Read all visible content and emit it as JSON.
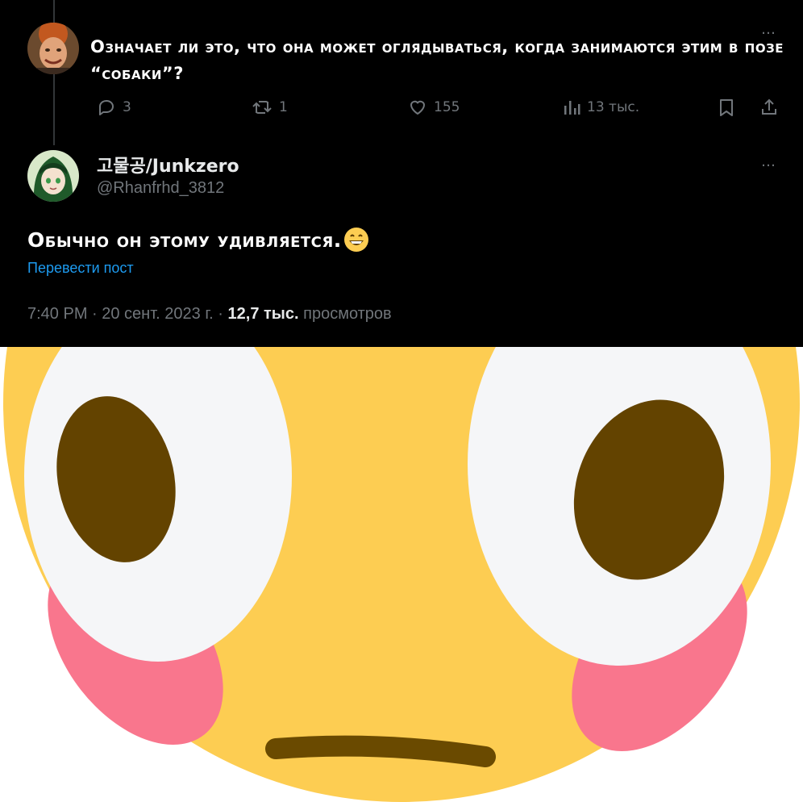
{
  "parent_tweet": {
    "text": "Означает ли это, что она может оглядываться, когда занимаются этим в позе “собаки”?",
    "more_icon": "…",
    "actions": {
      "reply_count": "3",
      "retweet_count": "1",
      "like_count": "155",
      "views": "13 тыс."
    }
  },
  "reply_tweet": {
    "name": "고물공/Junkzero",
    "handle": "@Rhanfrhd_3812",
    "more_icon": "…",
    "text": "Обычно он этому удивляется.",
    "emoji": "grinning-face-emoji",
    "translate_label": "Перевести пост",
    "time_date": "7:40 PM · 20 сент. 2023 г. · ",
    "views_count": "12,7 тыс.",
    "views_label": " просмотров"
  },
  "reaction_image": {
    "description_icon": "flushed-face-emoji",
    "colors": {
      "face": "#fdcd52",
      "eye_white": "#f5f6f8",
      "pupil": "#634300",
      "blush": "#f9768d",
      "mouth": "#6a4a00"
    }
  }
}
